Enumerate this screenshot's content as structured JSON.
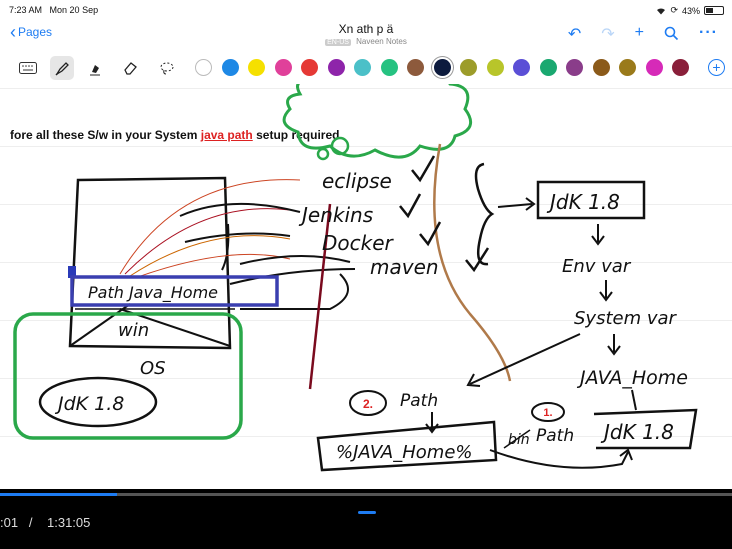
{
  "status_bar": {
    "time": "7:23 AM",
    "date": "Mon 20 Sep",
    "battery": "43%",
    "battery_level": 0.43
  },
  "nav": {
    "back_label": "Pages",
    "title": "Xn ath p ä",
    "language": "EN-US",
    "subtitle": "Naveen Notes",
    "icons": [
      "undo-icon",
      "redo-icon",
      "add-icon",
      "search-icon",
      "more-icon"
    ]
  },
  "toolbar": {
    "tools": [
      "keyboard-icon",
      "pen-icon",
      "highlighter-icon",
      "eraser-icon",
      "lasso-icon"
    ],
    "colors": [
      "#ffffff",
      "#1e88e5",
      "#f5e000",
      "#e0409a",
      "#e53935",
      "#8e24aa",
      "#4bc0c8",
      "#26c281",
      "#8d5a3c",
      "#0d1b3e",
      "#9c9c2a",
      "#b8c52a",
      "#5b4fd6",
      "#1aa870",
      "#8a3d8a",
      "#8b5a1a",
      "#9a7a1a",
      "#d62ab8",
      "#8a1f3a"
    ],
    "selected_color": "#0d1b3e"
  },
  "note": {
    "header_pre": "fore all these S/w  in your System ",
    "header_highlight": "java path",
    "header_post": " setup required",
    "handwriting": {
      "tools": [
        "eclipse",
        "Jenkins",
        "Docker",
        "maven"
      ],
      "path_box": "Path Java_Home",
      "win": "win",
      "os": "OS",
      "jdk_left": "JdK 1.8",
      "jdk_top": "JdK 1.8",
      "env_var": "Env var",
      "system_var": "System var",
      "java_home": "JAVA_Home",
      "path": "Path",
      "java_home_var": "%JAVA_Home%",
      "bin": "bin",
      "path2": "Path",
      "jdk_bottom": "JdK 1.8"
    },
    "markers": [
      "2.",
      "1."
    ]
  },
  "video": {
    "current_time": ":01",
    "separator": "/",
    "duration": "1:31:05",
    "progress": 0.16
  }
}
